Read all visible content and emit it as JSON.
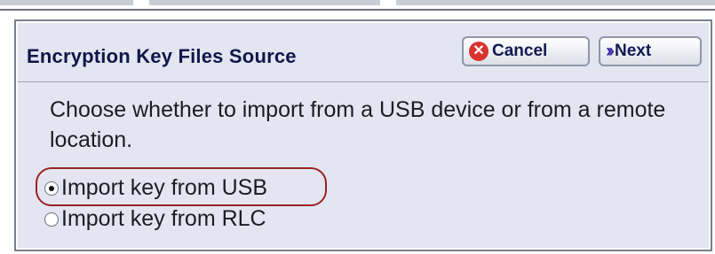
{
  "dialog": {
    "title": "Encryption Key Files Source",
    "cancel_label": "Cancel",
    "next_label": "Next",
    "instructions": "Choose whether to import from a USB device or from a remote location.",
    "options": [
      {
        "label": "Import key from USB",
        "selected": true
      },
      {
        "label": "Import key from RLC",
        "selected": false
      }
    ]
  },
  "icons": {
    "cancel": "cancel-x-icon",
    "next": "double-chevron-right-icon",
    "cancel_icon_color": "#d9332f",
    "next_icon_color": "#3b2aa6"
  },
  "colors": {
    "panel_background": "#e3e6f0",
    "title_text": "#10164a",
    "highlight_ring": "#9b2222"
  }
}
